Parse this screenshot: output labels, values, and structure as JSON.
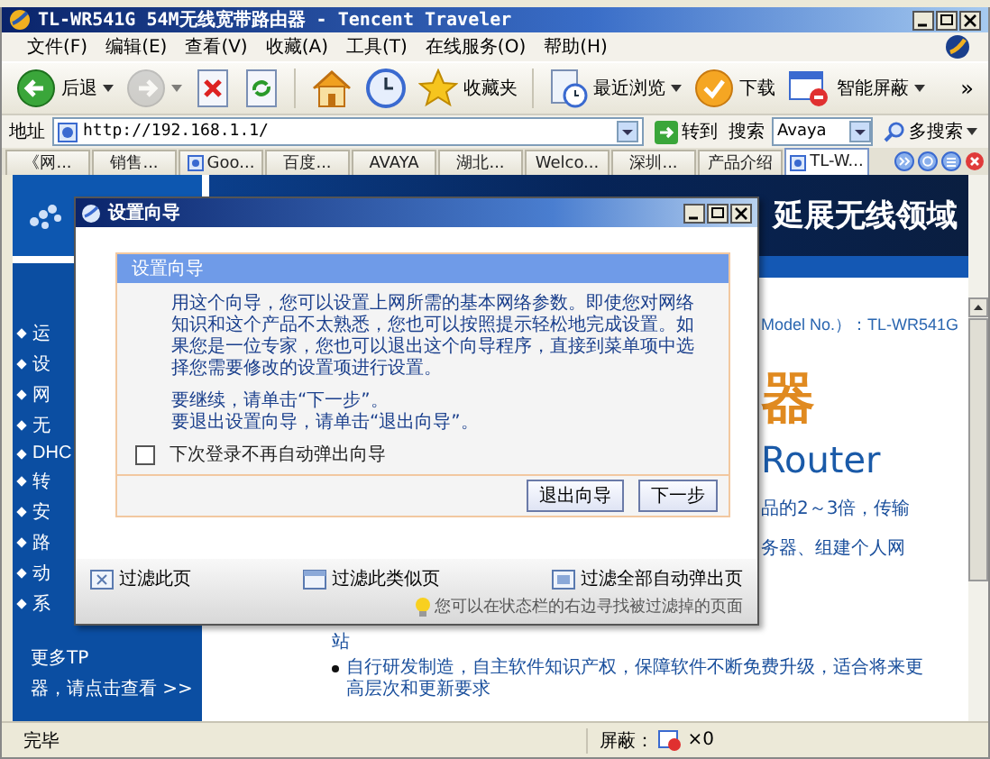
{
  "window": {
    "title": "TL-WR541G 54M无线宽带路由器 - Tencent Traveler"
  },
  "menu": [
    "文件(F)",
    "编辑(E)",
    "查看(V)",
    "收藏(A)",
    "工具(T)",
    "在线服务(O)",
    "帮助(H)"
  ],
  "toolbar": [
    {
      "kind": "back",
      "label": "后退",
      "dropdown": true,
      "disabled": false
    },
    {
      "kind": "forward",
      "dropdown": true,
      "disabled": true
    },
    {
      "kind": "stop",
      "dropdown": false,
      "disabled": false
    },
    {
      "kind": "refresh",
      "dropdown": false,
      "disabled": false
    },
    {
      "kind": "separator"
    },
    {
      "kind": "home",
      "dropdown": false,
      "disabled": false
    },
    {
      "kind": "history",
      "dropdown": false,
      "disabled": false
    },
    {
      "kind": "favorites",
      "label": "收藏夹",
      "dropdown": false,
      "disabled": false
    },
    {
      "kind": "separator"
    },
    {
      "kind": "recent",
      "label": "最近浏览",
      "dropdown": true,
      "disabled": false
    },
    {
      "kind": "download",
      "label": "下载",
      "dropdown": false,
      "disabled": false
    },
    {
      "kind": "block",
      "label": "智能屏蔽",
      "dropdown": true,
      "disabled": false
    },
    {
      "kind": "overflow",
      "label": "»",
      "dropdown": false,
      "disabled": false
    }
  ],
  "address": {
    "label": "地址",
    "url": "http://192.168.1.1/",
    "go": "转到",
    "search_label": "搜索",
    "search_engine": "Avaya",
    "multi_search": "多搜索"
  },
  "tabs": [
    {
      "label": "《网...",
      "kind": "plain",
      "selected": false
    },
    {
      "label": "销售...",
      "kind": "plain",
      "selected": false
    },
    {
      "label": "Goo...",
      "kind": "icon",
      "selected": false
    },
    {
      "label": "百度...",
      "kind": "plain",
      "selected": false
    },
    {
      "label": "AVAYA",
      "kind": "plain",
      "selected": false
    },
    {
      "label": "湖北...",
      "kind": "plain",
      "selected": false
    },
    {
      "label": "Welco...",
      "kind": "plain",
      "selected": false
    },
    {
      "label": "深圳...",
      "kind": "plain",
      "selected": false
    },
    {
      "label": "产品介绍",
      "kind": "plain",
      "selected": false
    },
    {
      "label": "TL-W...",
      "kind": "icon",
      "selected": true
    }
  ],
  "page": {
    "sidebar": {
      "nav": [
        "运",
        "设",
        "网",
        "无",
        "DHC",
        "转",
        "安",
        "路",
        "动",
        "系"
      ],
      "more": [
        "更多TP",
        "器，请点击查看 >>"
      ]
    },
    "banner": "延展无线领域",
    "model": "Model No.）：TL-WR541G",
    "heading": "器",
    "router": "Router",
    "fragments": [
      "品的2～3倍，传输",
      "务器、组建个人网"
    ],
    "fragment_tail": "站",
    "bullets": [
      "自行研发制造，自主软件知识产权，保障软件不断免费升级，适合将来更高层次和更新要求"
    ]
  },
  "popup": {
    "title": "设置向导",
    "header": "设置向导",
    "intro": "用这个向导，您可以设置上网所需的基本网络参数。即使您对网络知识和这个产品不太熟悉，您也可以按照提示轻松地完成设置。如果您是一位专家，您也可以退出这个向导程序，直接到菜单项中选择您需要修改的设置项进行设置。",
    "lines": [
      "要继续，请单击“下一步”。",
      "要退出设置向导，请单击“退出向导”。"
    ],
    "checkbox": {
      "label": "下次登录不再自动弹出向导",
      "checked": false
    },
    "buttons": [
      "退出向导",
      "下一步"
    ],
    "filters": [
      {
        "kind": "page",
        "label": "过滤此页"
      },
      {
        "kind": "similar",
        "label": "过滤此类似页"
      },
      {
        "kind": "all",
        "label": "过滤全部自动弹出页"
      }
    ],
    "hint": "您可以在状态栏的右边寻找被过滤掉的页面"
  },
  "status": {
    "text": "完毕",
    "blocked_label": "屏蔽：",
    "blocked_count": "×0"
  }
}
